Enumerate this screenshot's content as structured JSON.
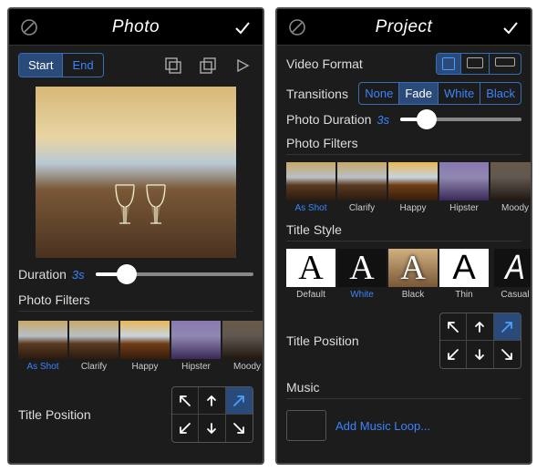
{
  "left": {
    "title": "Photo",
    "tabs": {
      "start": "Start",
      "end": "End"
    },
    "duration_label": "Duration",
    "duration_value": "3s",
    "filters_label": "Photo Filters",
    "filters": [
      {
        "name": "As Shot",
        "active": true,
        "cls": "f-asshot"
      },
      {
        "name": "Clarify",
        "active": false,
        "cls": "f-clarify"
      },
      {
        "name": "Happy",
        "active": false,
        "cls": "f-happy"
      },
      {
        "name": "Hipster",
        "active": false,
        "cls": "f-hipster"
      },
      {
        "name": "Moody",
        "active": false,
        "cls": "f-moody"
      }
    ],
    "title_position_label": "Title Position",
    "slider_percent": 20
  },
  "right": {
    "title": "Project",
    "video_format_label": "Video Format",
    "transitions_label": "Transitions",
    "transitions": [
      "None",
      "Fade",
      "White",
      "Black"
    ],
    "transitions_active": "Fade",
    "photo_duration_label": "Photo Duration",
    "photo_duration_value": "3s",
    "photo_duration_percent": 22,
    "filters_label": "Photo Filters",
    "filters": [
      {
        "name": "As Shot",
        "active": true,
        "cls": "f-asshot"
      },
      {
        "name": "Clarify",
        "active": false,
        "cls": "f-clarify"
      },
      {
        "name": "Happy",
        "active": false,
        "cls": "f-happy"
      },
      {
        "name": "Hipster",
        "active": false,
        "cls": "f-hipster"
      },
      {
        "name": "Moody",
        "active": false,
        "cls": "f-moody"
      }
    ],
    "title_style_label": "Title Style",
    "title_styles": [
      {
        "name": "Default",
        "cls": "ts-default"
      },
      {
        "name": "White",
        "cls": "ts-white",
        "active": true
      },
      {
        "name": "Black",
        "cls": "ts-black"
      },
      {
        "name": "Thin",
        "cls": "ts-thin"
      },
      {
        "name": "Casual",
        "cls": "ts-casual"
      }
    ],
    "title_position_label": "Title Position",
    "music_label": "Music",
    "add_music_label": "Add Music Loop..."
  },
  "tp_active_index": 2
}
